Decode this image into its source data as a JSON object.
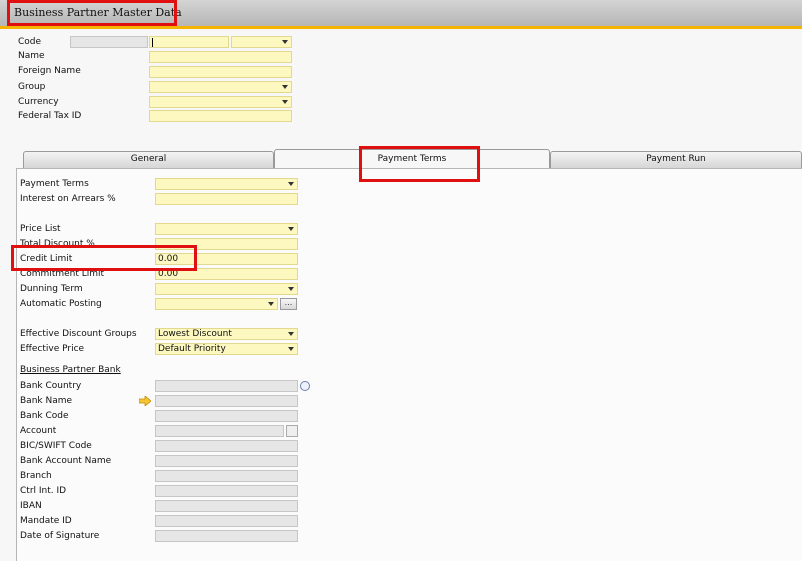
{
  "window": {
    "title": "Business Partner Master Data"
  },
  "header": {
    "code_label": "Code",
    "name_label": "Name",
    "foreign_name_label": "Foreign Name",
    "group_label": "Group",
    "currency_label": "Currency",
    "federal_tax_id_label": "Federal Tax ID"
  },
  "tabs": [
    {
      "label": "General"
    },
    {
      "label": "Payment Terms"
    },
    {
      "label": "Payment Run"
    }
  ],
  "payment_terms": {
    "payment_terms_label": "Payment Terms",
    "interest_on_arrears_label": "Interest on Arrears %",
    "price_list_label": "Price List",
    "total_discount_label": "Total Discount %",
    "credit_limit_label": "Credit Limit",
    "credit_limit_value": "0.00",
    "commitment_limit_label": "Commitment Limit",
    "commitment_limit_value": "0.00",
    "dunning_term_label": "Dunning Term",
    "automatic_posting_label": "Automatic Posting",
    "ellipsis": "...",
    "effective_discount_groups_label": "Effective Discount Groups",
    "effective_discount_groups_value": "Lowest Discount",
    "effective_price_label": "Effective Price",
    "effective_price_value": "Default Priority"
  },
  "bank": {
    "section_title": "Business Partner Bank",
    "bank_country_label": "Bank Country",
    "bank_name_label": "Bank Name",
    "bank_code_label": "Bank Code",
    "account_label": "Account",
    "bic_swift_label": "BIC/SWIFT Code",
    "bank_account_name_label": "Bank Account Name",
    "branch_label": "Branch",
    "ctrl_int_id_label": "Ctrl Int. ID",
    "iban_label": "IBAN",
    "mandate_id_label": "Mandate ID",
    "date_of_signature_label": "Date of Signature"
  },
  "colors": {
    "field_yellow": "#fdf8c0",
    "highlight_red": "#e01010",
    "title_accent": "#f4b400"
  }
}
